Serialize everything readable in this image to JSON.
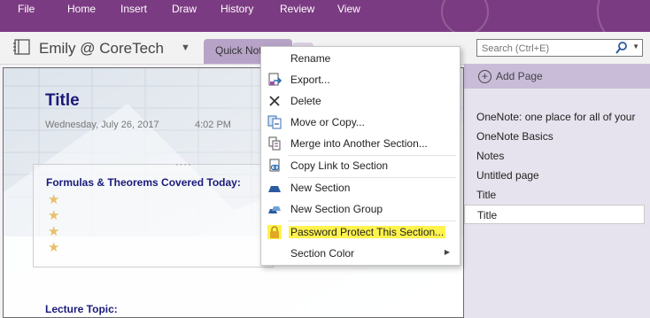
{
  "ribbon": {
    "tabs": [
      "File",
      "Home",
      "Insert",
      "Draw",
      "History",
      "Review",
      "View"
    ]
  },
  "notebook": {
    "name": "Emily @ CoreTech",
    "section_tab": "Quick Notes"
  },
  "search": {
    "placeholder": "Search (Ctrl+E)"
  },
  "page": {
    "title": "Title",
    "date": "Wednesday, July 26, 2017",
    "time": "4:02 PM",
    "note_heading": "Formulas & Theorems Covered Today:",
    "star_glyph": "★",
    "lecture_label": "Lecture Topic:"
  },
  "pages_pane": {
    "add_page": "Add Page",
    "items": [
      "OneNote: one place for all of your",
      "OneNote Basics",
      "Notes",
      "Untitled page",
      "Title",
      "Title"
    ],
    "selected_index": 5
  },
  "context_menu": {
    "items": [
      {
        "label": "Rename",
        "icon": "rename-icon"
      },
      {
        "label": "Export...",
        "icon": "export-icon"
      },
      {
        "label": "Delete",
        "icon": "delete-icon"
      },
      {
        "label": "Move or Copy...",
        "icon": "move-copy-icon"
      },
      {
        "label": "Merge into Another Section...",
        "icon": "merge-icon"
      },
      {
        "label": "Copy Link to Section",
        "icon": "copy-link-icon"
      },
      {
        "label": "New Section",
        "icon": "new-section-icon"
      },
      {
        "label": "New Section Group",
        "icon": "new-section-group-icon"
      },
      {
        "label": "Password Protect This Section...",
        "icon": "lock-icon"
      },
      {
        "label": "Section Color",
        "icon": ""
      }
    ],
    "highlight_color": "#fff34d"
  },
  "colors": {
    "ribbon": "#7b3b82",
    "section_tab": "#b8a3c8",
    "add_page_bar": "#c9bcd9",
    "title_text": "#1a1a7a"
  }
}
